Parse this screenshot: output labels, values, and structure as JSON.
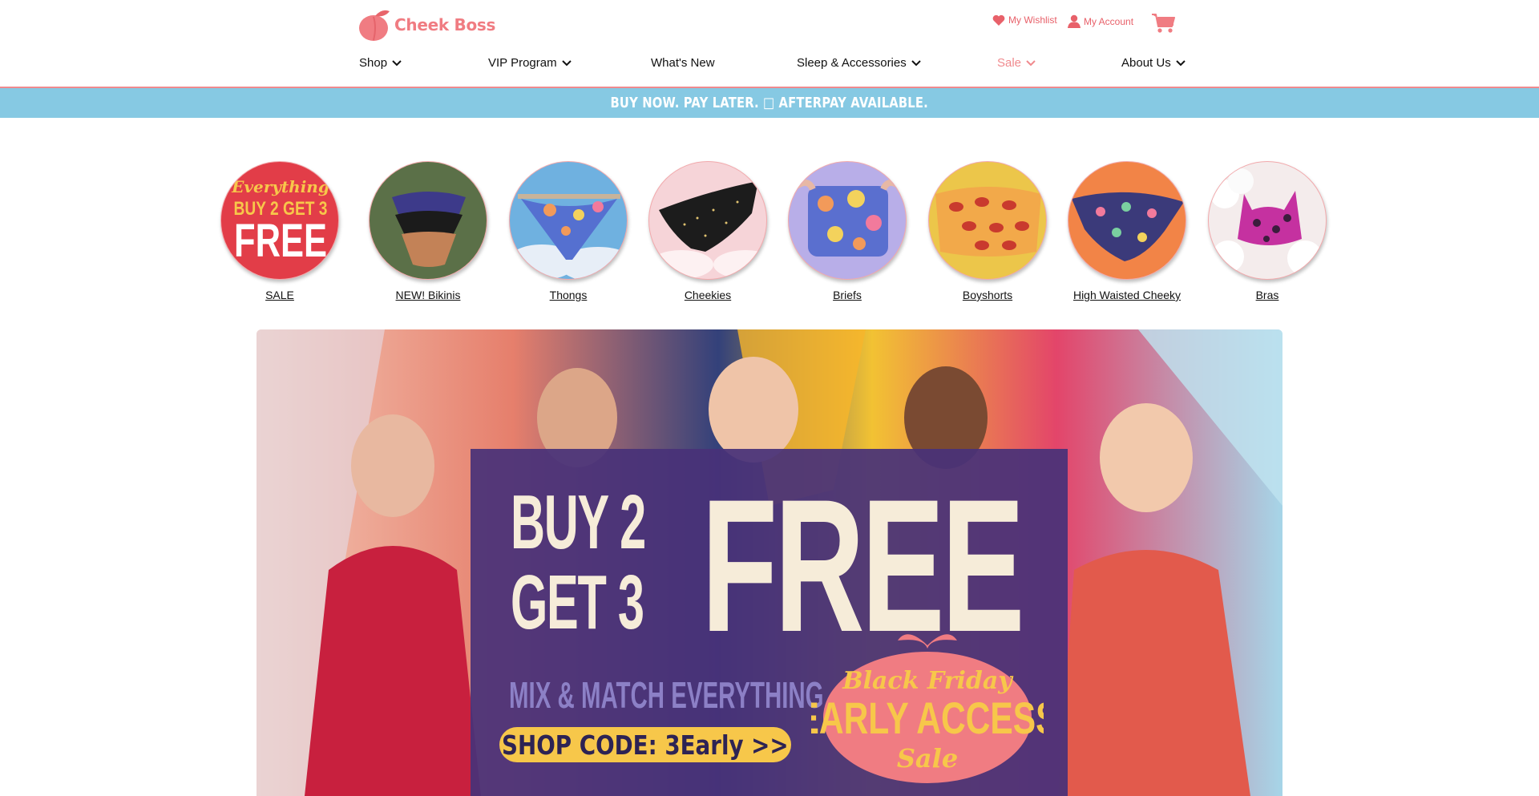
{
  "brand": {
    "name": "Cheek Boss"
  },
  "utility": {
    "wishlist": "My Wishlist",
    "account": "My Account"
  },
  "nav": [
    {
      "label": "Shop",
      "dropdown": true
    },
    {
      "label": "VIP Program",
      "dropdown": true
    },
    {
      "label": "What's New",
      "dropdown": false
    },
    {
      "label": "Sleep & Accessories",
      "dropdown": true
    },
    {
      "label": "Sale",
      "dropdown": true
    },
    {
      "label": "About Us",
      "dropdown": true
    }
  ],
  "promo": {
    "text": "BUY NOW. PAY LATER. □ AFTERPAY AVAILABLE."
  },
  "categories": [
    {
      "label": "SALE",
      "circle_text": [
        "Everything",
        "BUY 2 GET 3",
        "FREE"
      ]
    },
    {
      "label": "NEW! Bikinis"
    },
    {
      "label": "Thongs"
    },
    {
      "label": "Cheekies"
    },
    {
      "label": "Briefs"
    },
    {
      "label": "Boyshorts"
    },
    {
      "label": "High Waisted Cheeky"
    },
    {
      "label": "Bras"
    }
  ],
  "hero": {
    "line1": "BUY 2",
    "line2": "GET 3",
    "big": "FREE",
    "sub": "MIX & MATCH EVERYTHING",
    "code": "SHOP CODE: 3Early >>",
    "badge_top": "Black Friday",
    "badge_mid": "EARLY ACCESS",
    "badge_bottom": "Sale"
  },
  "colors": {
    "accent": "#f07c82",
    "promo_bar": "#86c9e3",
    "panel": "#483278",
    "code_pill": "#f7c74a",
    "cream": "#f6ecd9"
  },
  "icons": [
    "peach-logo-icon",
    "heart-icon",
    "user-icon",
    "cart-icon",
    "chevron-down-icon"
  ]
}
